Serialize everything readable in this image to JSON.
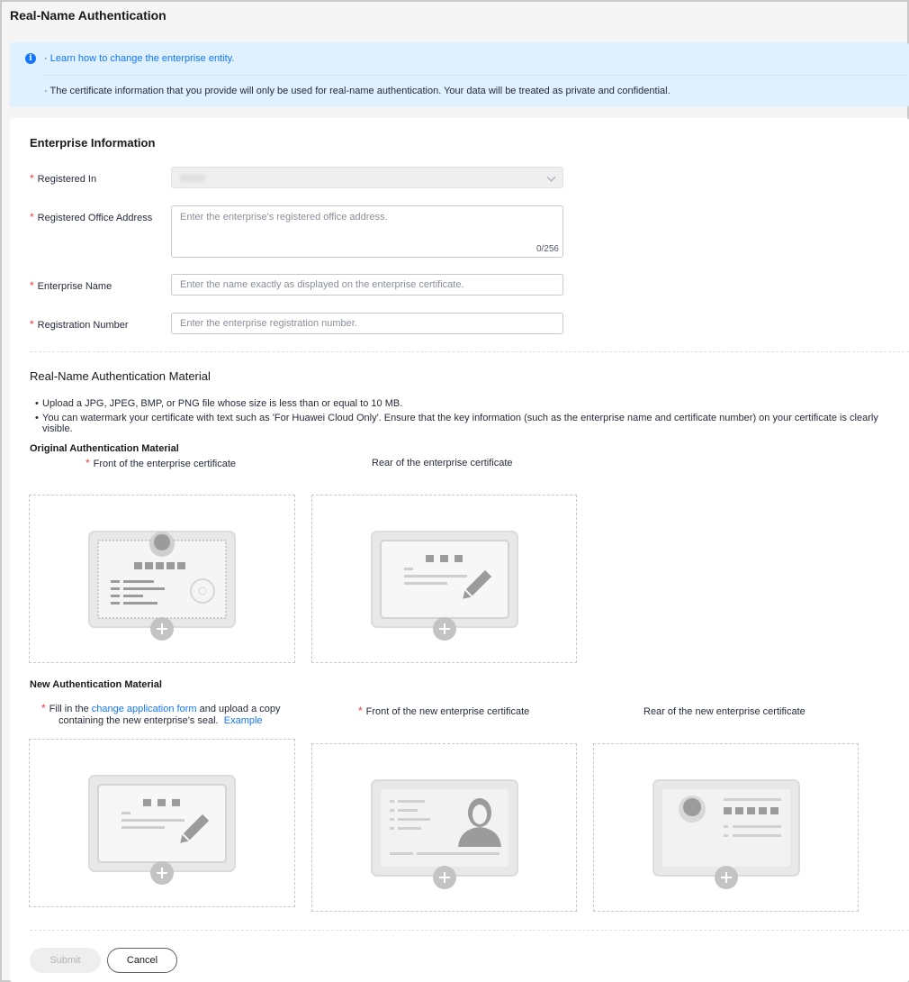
{
  "page": {
    "title": "Real-Name Authentication"
  },
  "notice": {
    "prefix1": "· ",
    "link": "Learn how to change the enterprise entity.",
    "line2": "· The certificate information that you provide will only be used for real-name authentication. Your data will be treated as private and confidential."
  },
  "enterprise": {
    "title": "Enterprise Information",
    "registered_in": {
      "label": "Registered In"
    },
    "address": {
      "label": "Registered Office Address",
      "placeholder": "Enter the enterprise's registered office address.",
      "counter": "0/256"
    },
    "name": {
      "label": "Enterprise Name",
      "placeholder": "Enter the name exactly as displayed on the enterprise certificate."
    },
    "reg_number": {
      "label": "Registration Number",
      "placeholder": "Enter the enterprise registration number."
    }
  },
  "material": {
    "title": "Real-Name Authentication Material",
    "rules": [
      "Upload a JPG, JPEG, BMP, or PNG file whose size is less than or equal to 10 MB.",
      "You can watermark your certificate with text such as 'For Huawei Cloud Only'. Ensure that the key information (such as the enterprise name and certificate number) on your certificate is clearly visible."
    ],
    "original": {
      "title": "Original Authentication Material",
      "front": "Front of the enterprise certificate",
      "rear": "Rear of the enterprise certificate"
    },
    "new": {
      "title": "New Authentication Material",
      "form_pre": "Fill in the ",
      "form_link": "change application form",
      "form_mid": " and upload a copy",
      "form_line2": "containing the new enterprise's seal.",
      "example_link": "Example",
      "front": "Front of the new enterprise certificate",
      "rear": "Rear of the new enterprise certificate"
    }
  },
  "actions": {
    "submit": "Submit",
    "cancel": "Cancel"
  },
  "colors": {
    "accent": "#1476ff",
    "required": "#f03b3b",
    "notice_bg": "#dff0fe"
  }
}
